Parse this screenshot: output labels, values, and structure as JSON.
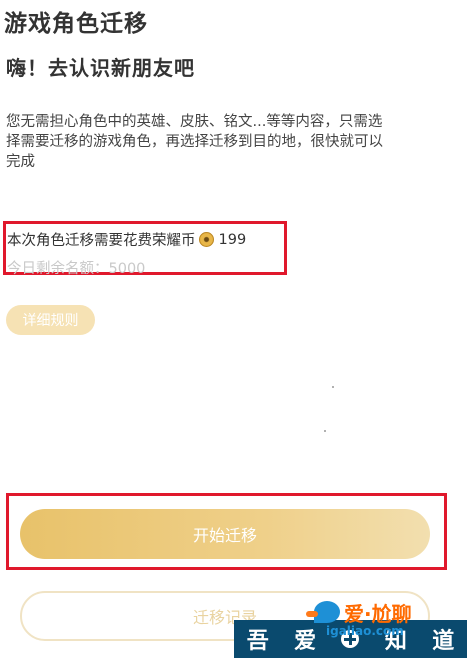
{
  "page": {
    "title": "游戏角色迁移",
    "subtitle": "嗨！去认识新朋友吧",
    "description_lines": [
      "您无需担心角色中的英雄、皮肤、铭文...等等内容，只需选",
      "择需要迁移的游戏角色，再选择迁移到目的地，很快就可以",
      "完成"
    ]
  },
  "cost": {
    "label": "本次角色迁移需要花费荣耀币",
    "icon": "coin-icon",
    "amount": "199",
    "quota": "今日剩余名额：5000"
  },
  "buttons": {
    "rules": "详细规则",
    "start": "开始迁移",
    "record": "迁移记录"
  },
  "watermark": {
    "brand": "爱·尬聊",
    "url": "igaliao.com",
    "strip": [
      "吾",
      "爱",
      "知",
      "道"
    ]
  },
  "colors": {
    "accent_gold": "#e8c26a",
    "highlight_red": "#e0182c",
    "quota_gray": "#c9c9c9"
  }
}
